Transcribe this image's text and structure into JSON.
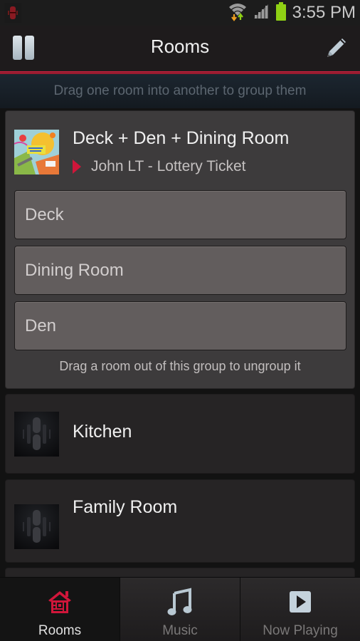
{
  "status_bar": {
    "time": "3:55 PM",
    "icons": [
      "app-notification-icon",
      "wifi-data-icon",
      "signal-icon",
      "battery-icon"
    ],
    "battery_color": "#8fd014"
  },
  "app_bar": {
    "title": "Rooms",
    "left_button": "pause-icon",
    "right_button": "edit-pencil-icon",
    "accent_color": "#c42040"
  },
  "hint": {
    "text": "Drag one room into another to group them"
  },
  "group": {
    "title": "Deck + Den + Dining Room",
    "now_playing": "John LT - Lottery Ticket",
    "play_indicator_color": "#d0163a",
    "members": [
      {
        "name": "Deck"
      },
      {
        "name": "Dining Room"
      },
      {
        "name": "Den"
      }
    ],
    "ungroup_hint": "Drag a room out of this group to ungroup it"
  },
  "rooms": [
    {
      "name": "Kitchen"
    },
    {
      "name": "Family Room"
    }
  ],
  "bottom_nav": {
    "tabs": [
      {
        "label": "Rooms",
        "icon": "house-icon",
        "active": true
      },
      {
        "label": "Music",
        "icon": "music-note-icon",
        "active": false
      },
      {
        "label": "Now Playing",
        "icon": "play-box-icon",
        "active": false
      }
    ],
    "active_color": "#d0163a"
  }
}
